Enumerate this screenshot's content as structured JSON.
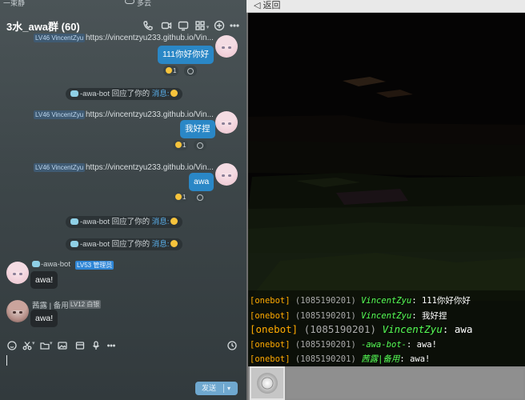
{
  "status": {
    "left": "一束静",
    "weather": "多云"
  },
  "chat": {
    "title": "3水_awa群 (60)",
    "messages": {
      "m1_level": "LV46 VincentZyu",
      "m1_url": "https://vincentzyu233.github.io/Vin...",
      "m1_text": "111你好你好",
      "m1_react_count": "1",
      "sys1_name": "-awa-bot",
      "sys1_text": "回应了你的",
      "sys1_link": "消息:",
      "m2_level": "LV46 VincentZyu",
      "m2_url": "https://vincentzyu233.github.io/Vin...",
      "m2_text": "我好捏",
      "m2_react_count": "1",
      "m3_level": "LV46 VincentZyu",
      "m3_url": "https://vincentzyu233.github.io/Vin...",
      "m3_text": "awa",
      "m3_react_count": "1",
      "sys2_name": "-awa-bot",
      "sys2_text": "回应了你的",
      "sys2_link": "消息:",
      "sys3_name": "-awa-bot",
      "sys3_text": "回应了你的",
      "sys3_link": "消息:",
      "bot_name": "-awa-bot",
      "bot_level": "LV53 管理员",
      "bot_text": "awa!",
      "xl_name": "茜露 | 备用",
      "xl_level": "LV12 白银",
      "xl_text": "awa!"
    },
    "send_label": "发送"
  },
  "game": {
    "back_label": "返回",
    "lines": [
      {
        "tag": "[onebot]",
        "id": "(1085190201)",
        "name": "VincentZyu",
        "text": ": 111你好你好"
      },
      {
        "tag": "[onebot]",
        "id": "(1085190201)",
        "name": "VincentZyu",
        "text": ": 我好捏"
      },
      {
        "tag": "[onebot]",
        "id": "(1085190201)",
        "name": "VincentZyu",
        "text": ": awa"
      },
      {
        "tag": "[onebot]",
        "id": "(1085190201)",
        "name": "-awa-bot-",
        "text": ": awa!"
      },
      {
        "tag": "[onebot]",
        "id": "(1085190201)",
        "name": "茜露|备用",
        "text": ": awa!"
      }
    ]
  }
}
